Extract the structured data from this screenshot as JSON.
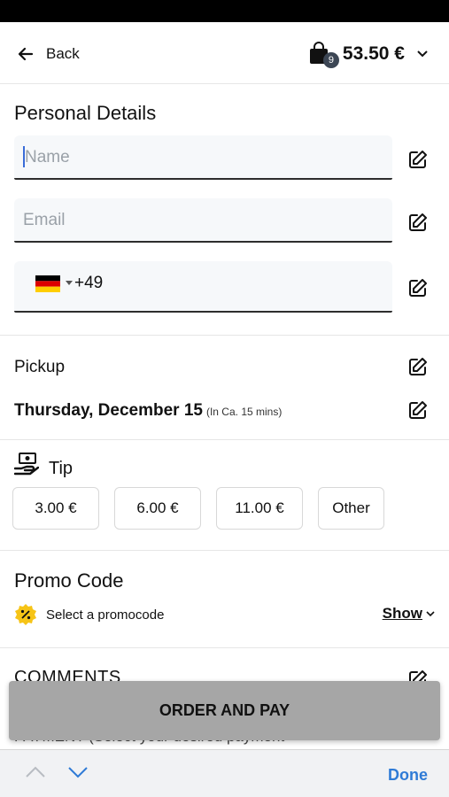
{
  "header": {
    "back_label": "Back",
    "cart_count": "9",
    "cart_total": "53.50 €"
  },
  "personal": {
    "title": "Personal Details",
    "name_placeholder": "Name",
    "email_placeholder": "Email",
    "dial_code": "+49"
  },
  "pickup": {
    "label": "Pickup",
    "date": "Thursday, December 15",
    "note": "(In Ca. 15 mins)"
  },
  "tip": {
    "title": "Tip",
    "options": [
      "3.00 €",
      "6.00 €",
      "11.00 €",
      "Other"
    ]
  },
  "promo": {
    "title": "Promo Code",
    "select_label": "Select a promocode",
    "show_label": "Show"
  },
  "comments": {
    "title": "COMMENTS",
    "payment_peek": "PAYMENT (Select your desired payment"
  },
  "order": {
    "button_label": "ORDER AND PAY"
  },
  "keyboard": {
    "done_label": "Done"
  },
  "colors": {
    "accent": "#2f7bd6",
    "button_disabled": "#a6a6a6",
    "badge": "#3c4654",
    "promo": "#f6c417"
  }
}
